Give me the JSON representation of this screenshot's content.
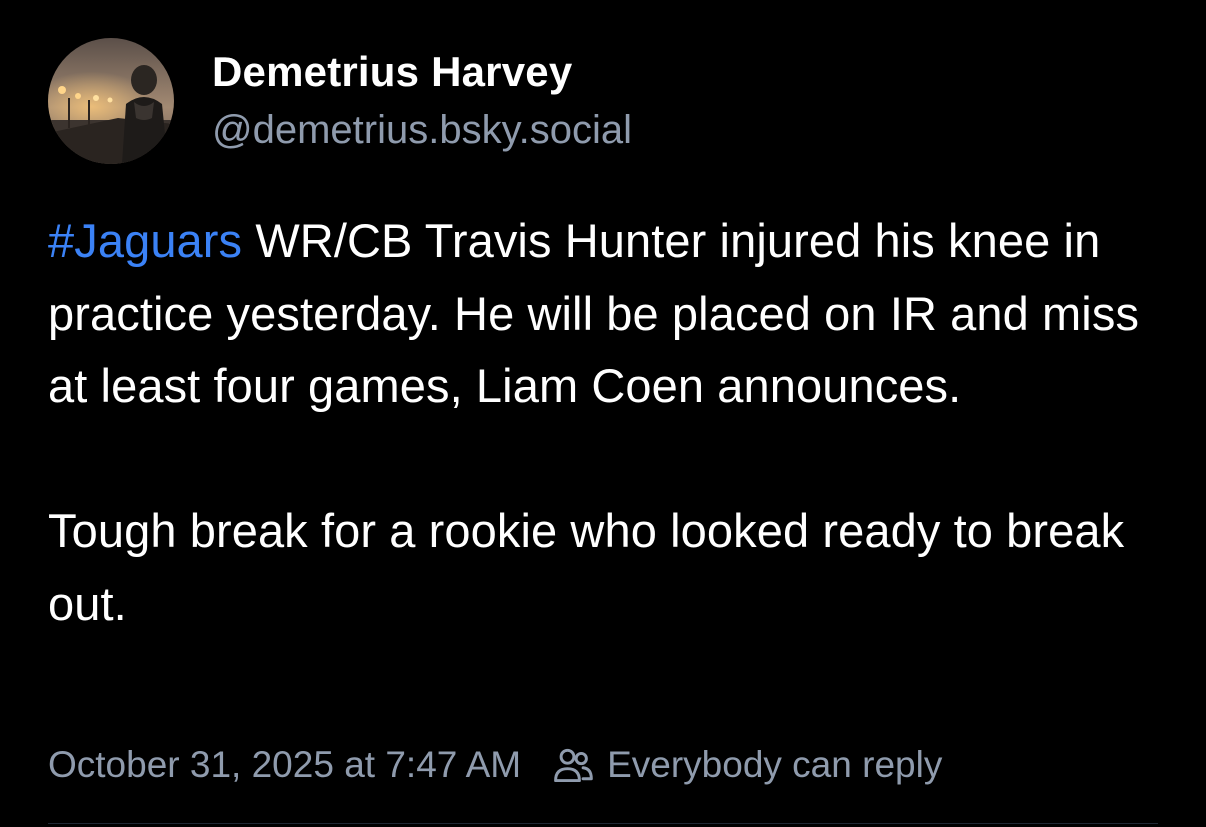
{
  "post": {
    "author": {
      "display_name": "Demetrius Harvey",
      "handle": "@demetrius.bsky.social"
    },
    "text": {
      "hashtag": "#Jaguars",
      "paragraph1_rest": " WR/CB Travis Hunter injured his knee in practice yesterday. He will be placed on IR and miss at least four games, Liam Coen announces.",
      "paragraph2": "Tough break for a rookie who looked ready to break out."
    },
    "meta": {
      "timestamp": "October 31, 2025 at 7:47 AM",
      "reply_setting": "Everybody can reply",
      "reply_icon": "people-icon"
    }
  },
  "colors": {
    "background": "#000000",
    "text": "#ffffff",
    "muted": "#8f9bad",
    "hashtag": "#3b82f6"
  }
}
